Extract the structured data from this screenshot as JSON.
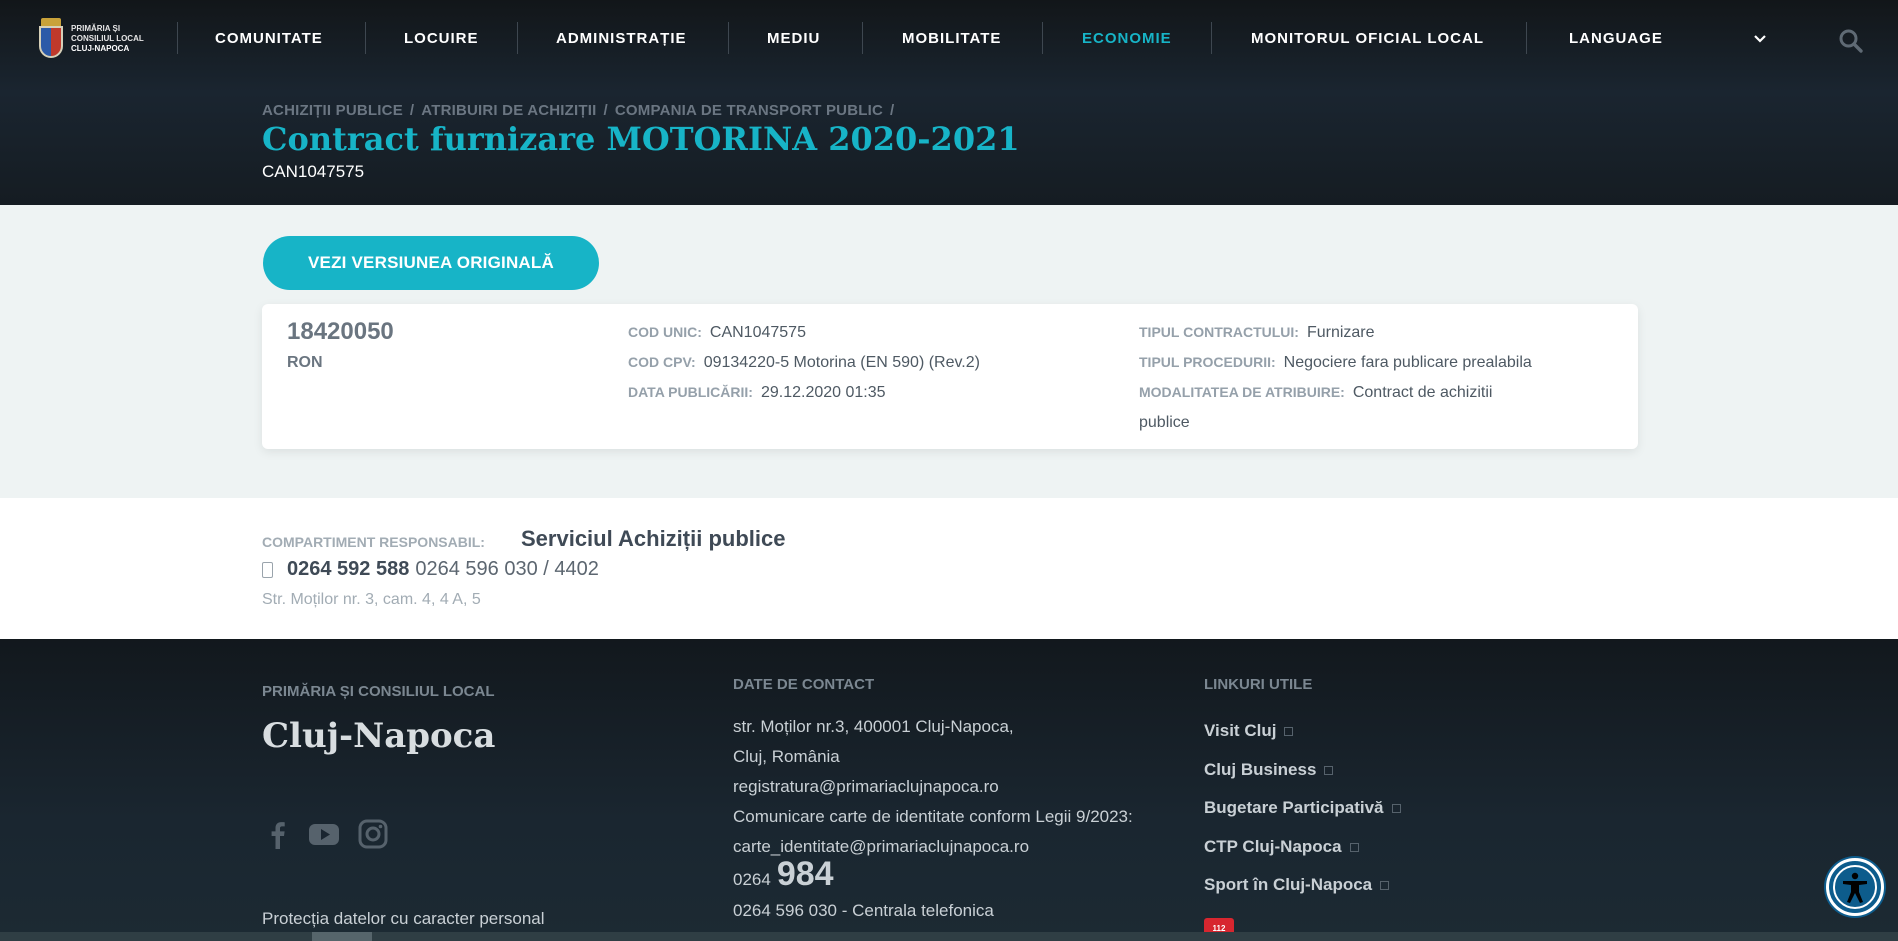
{
  "header": {
    "logo_text": [
      "PRIMĂRIA ȘI",
      "CONSILIUL LOCAL",
      "CLUJ-NAPOCA"
    ],
    "nav": [
      {
        "label": "COMUNITATE",
        "active": false
      },
      {
        "label": "LOCUIRE",
        "active": false
      },
      {
        "label": "ADMINISTRAȚIE",
        "active": false
      },
      {
        "label": "MEDIU",
        "active": false
      },
      {
        "label": "MOBILITATE",
        "active": false
      },
      {
        "label": "ECONOMIE",
        "active": true
      },
      {
        "label": "MONITORUL OFICIAL LOCAL",
        "active": false
      },
      {
        "label": "LANGUAGE",
        "active": false
      }
    ],
    "accent_color": "#17b4c7"
  },
  "breadcrumb": [
    "ACHIZIȚII PUBLICE",
    "ATRIBUIRI DE ACHIZIȚII",
    "COMPANIA DE TRANSPORT PUBLIC"
  ],
  "page": {
    "title": "Contract furnizare MOTORINA 2020-2021",
    "subtitle": "CAN1047575",
    "original_button": "VEZI VERSIUNEA ORIGINALĂ"
  },
  "contract": {
    "amount": "18420050",
    "currency": "RON",
    "cod_unic": {
      "label": "COD UNIC:",
      "value": "CAN1047575"
    },
    "cod_cpv": {
      "label": "COD CPV:",
      "value": "09134220-5 Motorina (EN 590) (Rev.2)"
    },
    "data_publicarii": {
      "label": "DATA PUBLICĂRII:",
      "value": "29.12.2020 01:35"
    },
    "tipul_contractului": {
      "label": "TIPUL CONTRACTULUI:",
      "value": "Furnizare"
    },
    "tipul_procedurii": {
      "label": "TIPUL PROCEDURII:",
      "value": "Negociere fara publicare prealabila"
    },
    "modalitatea": {
      "label": "MODALITATEA DE ATRIBUIRE:",
      "value_line1": "Contract de achizitii",
      "value_line2": "publice"
    }
  },
  "responsible": {
    "label": "COMPARTIMENT RESPONSABIL:",
    "value": "Serviciul Achiziții publice",
    "phone_main": "0264 592 588",
    "phone_extra": "0264 596 030 / 4402",
    "address": "Str. Moților nr. 3, cam. 4, 4 A, 5"
  },
  "footer": {
    "col1_heading": "PRIMĂRIA ȘI CONSILIUL LOCAL",
    "city": "Cluj-Napoca",
    "privacy": "Protecția datelor cu caracter personal",
    "col2_heading": "DATE DE CONTACT",
    "contact_lines": [
      "str. Moților nr.3, 400001 Cluj-Napoca,",
      "Cluj, România",
      "registratura@primariaclujnapoca.ro",
      "Comunicare carte de identitate conform Legii 9/2023:",
      "carte_identitate@primariaclujnapoca.ro"
    ],
    "short_prefix": "0264",
    "short_number": "984",
    "central_phone": "0264 596 030 - Centrala telefonica",
    "col3_heading": "LINKURI UTILE",
    "links": [
      "Visit Cluj",
      "Cluj Business",
      "Bugetare Participativă",
      "CTP Cluj-Napoca",
      "Sport în Cluj-Napoca"
    ],
    "badge_112": "112",
    "social_icons": [
      "facebook-icon",
      "youtube-icon",
      "instagram-icon"
    ]
  }
}
